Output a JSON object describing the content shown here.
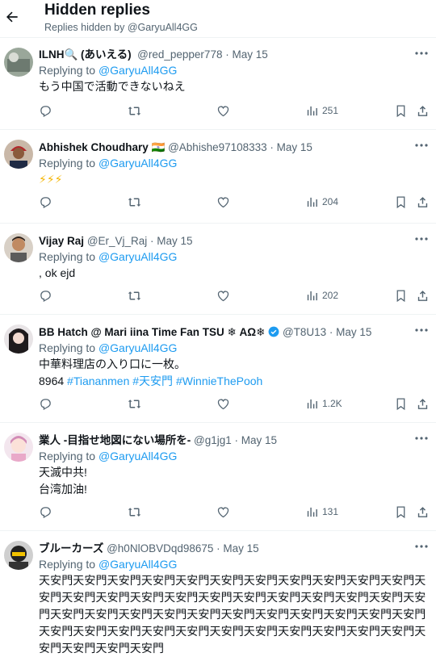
{
  "header": {
    "title": "Hidden replies",
    "subtitle": "Replies hidden by @GaryuAll4GG"
  },
  "replying_prefix": "Replying to",
  "tweets": [
    {
      "name": "ILNH🔍 (あいえる)",
      "handle": "@red_pepper778 · May 15",
      "replying_to": "@GaryuAll4GG",
      "lines": [
        "もう中国で活動できないねえ"
      ],
      "views": "251"
    },
    {
      "name": "Abhishek Choudhary 🇮🇳",
      "handle": "@Abhishe97108333 · May 15",
      "replying_to": "@GaryuAll4GG",
      "lines": [
        "⚡⚡⚡"
      ],
      "views": "204"
    },
    {
      "name": "Vijay Raj",
      "handle": "@Er_Vj_Raj · May 15",
      "replying_to": "@GaryuAll4GG",
      "lines": [
        ", ok ejd"
      ],
      "views": "202"
    },
    {
      "name": "BB Hatch @ Mari iina Time Fan TSU ❄ ΑΩ❄",
      "handle": "@T8U13 · May 15",
      "replying_to": "@GaryuAll4GG",
      "lines": [
        "中華料理店の入り口に一枚。"
      ],
      "line2_prefix": "8964 ",
      "hashtags": [
        "#Tiananmen",
        "#天安門",
        "#WinnieThePooh"
      ],
      "views": "1.2K"
    },
    {
      "name": "業人 -目指せ地図にない場所を-",
      "handle": "@g1jg1 · May 15",
      "replying_to": "@GaryuAll4GG",
      "lines": [
        "天滅中共!",
        "台湾加油!"
      ],
      "views": "131"
    },
    {
      "name": "ブルーカーズ",
      "handle": "@h0NlOBVDqd98675 · May 15",
      "replying_to": "@GaryuAll4GG",
      "lines": [
        "天安門天安門天安門天安門天安門天安門天安門天安門天安門天安門天安門天安門天安門天安門天安門天安門天安門天安門天安門天安門天安門天安門天安門天安門天安門天安門天安門天安門天安門天安門天安門天安門天安門天安門天安門天安門天安門天安門天安門天安門天安門天安門天安門天安門天安門天安門天安門天安門天安門"
      ]
    }
  ]
}
